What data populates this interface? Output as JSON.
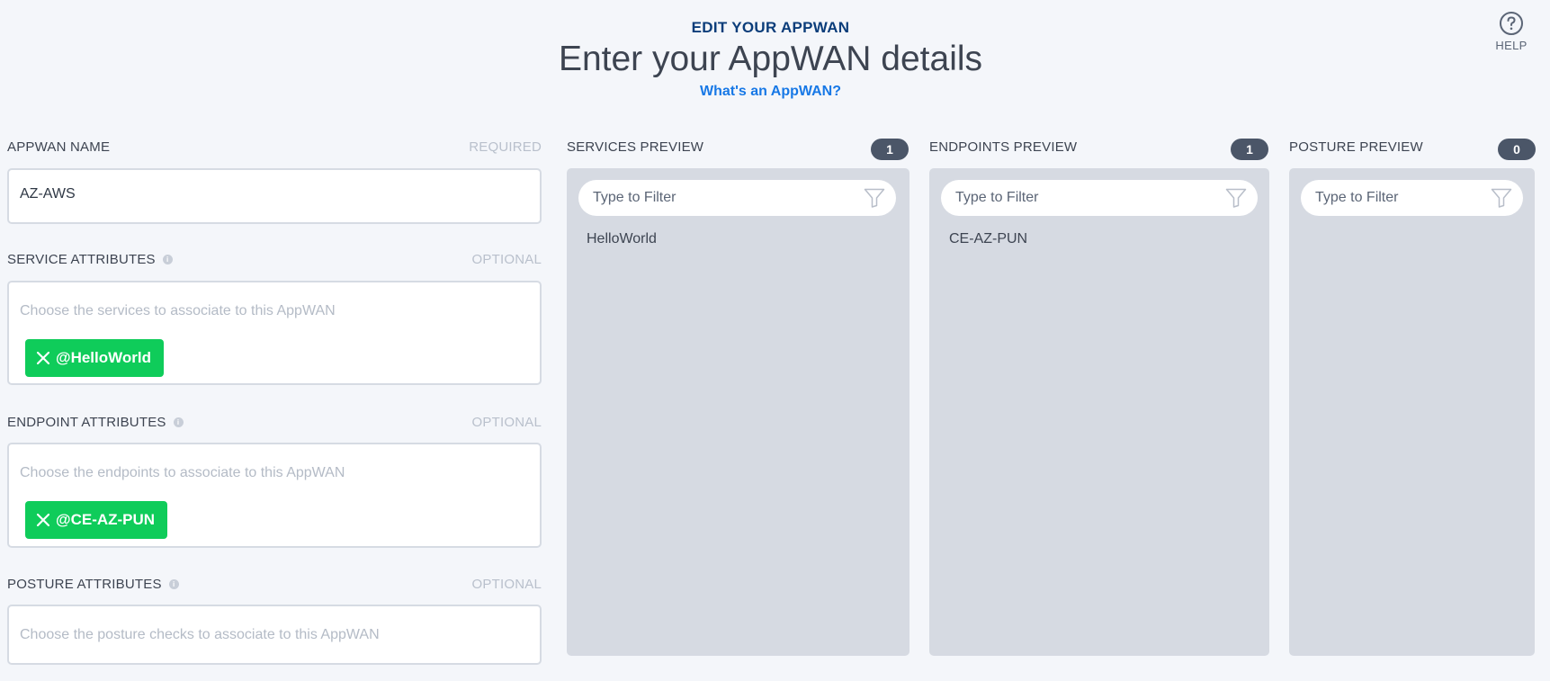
{
  "header": {
    "eyebrow": "EDIT YOUR APPWAN",
    "title": "Enter your AppWAN details",
    "link": "What's an AppWAN?",
    "help_label": "HELP"
  },
  "form": {
    "name": {
      "label": "APPWAN NAME",
      "hint": "REQUIRED",
      "value": "AZ-AWS"
    },
    "service_attributes": {
      "label": "SERVICE ATTRIBUTES",
      "hint": "OPTIONAL",
      "placeholder": "Choose the services to associate to this AppWAN",
      "chips": [
        "@HelloWorld"
      ]
    },
    "endpoint_attributes": {
      "label": "ENDPOINT ATTRIBUTES",
      "hint": "OPTIONAL",
      "placeholder": "Choose the endpoints to associate to this AppWAN",
      "chips": [
        "@CE-AZ-PUN"
      ]
    },
    "posture_attributes": {
      "label": "POSTURE ATTRIBUTES",
      "hint": "OPTIONAL",
      "placeholder": "Choose the posture checks to associate to this AppWAN",
      "chips": []
    }
  },
  "previews": {
    "services": {
      "label": "SERVICES PREVIEW",
      "count": "1",
      "filter_placeholder": "Type to Filter",
      "items": [
        "HelloWorld"
      ]
    },
    "endpoints": {
      "label": "ENDPOINTS PREVIEW",
      "count": "1",
      "filter_placeholder": "Type to Filter",
      "items": [
        "CE-AZ-PUN"
      ]
    },
    "posture": {
      "label": "POSTURE PREVIEW",
      "count": "0",
      "filter_placeholder": "Type to Filter",
      "items": []
    }
  },
  "colors": {
    "accent_green": "#0fcc5a",
    "link_blue": "#1778e6",
    "eyebrow_navy": "#0b3d7a",
    "badge": "#4b5668"
  },
  "icons": {
    "help": "question-circle-icon",
    "filter": "funnel-icon",
    "chip_remove": "close-icon",
    "info": "info-icon"
  }
}
